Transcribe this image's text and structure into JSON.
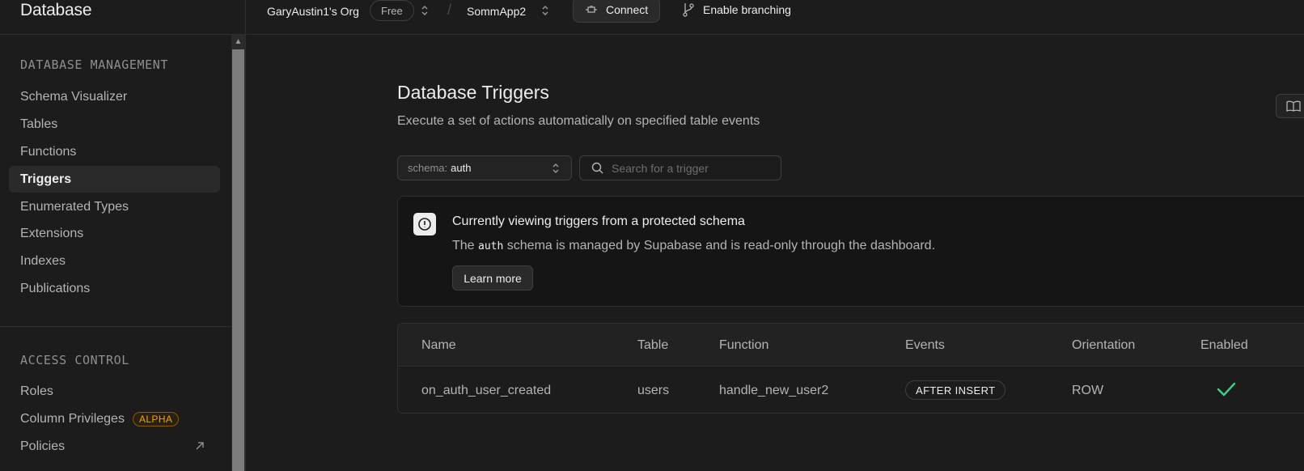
{
  "sidebar": {
    "title": "Database",
    "sections": [
      {
        "label": "DATABASE MANAGEMENT",
        "items": [
          {
            "label": "Schema Visualizer"
          },
          {
            "label": "Tables"
          },
          {
            "label": "Functions"
          },
          {
            "label": "Triggers",
            "active": true
          },
          {
            "label": "Enumerated Types"
          },
          {
            "label": "Extensions"
          },
          {
            "label": "Indexes"
          },
          {
            "label": "Publications"
          }
        ]
      },
      {
        "label": "ACCESS CONTROL",
        "items": [
          {
            "label": "Roles"
          },
          {
            "label": "Column Privileges",
            "badge": "ALPHA"
          },
          {
            "label": "Policies",
            "external": true
          }
        ]
      }
    ]
  },
  "topbar": {
    "org": "GaryAustin1's Org",
    "plan_badge": "Free",
    "project": "SommApp2",
    "connect_label": "Connect",
    "branching_label": "Enable branching"
  },
  "main": {
    "title": "Database Triggers",
    "subtitle": "Execute a set of actions automatically on specified table events",
    "schema_select": {
      "label": "schema:",
      "value": "auth"
    },
    "search": {
      "placeholder": "Search for a trigger",
      "value": ""
    },
    "alert": {
      "title": "Currently viewing triggers from a protected schema",
      "body_prefix": "The ",
      "body_code": "auth",
      "body_suffix": " schema is managed by Supabase and is read-only through the dashboard.",
      "button_label": "Learn more"
    },
    "table": {
      "columns": [
        "Name",
        "Table",
        "Function",
        "Events",
        "Orientation",
        "Enabled"
      ],
      "rows": [
        {
          "name": "on_auth_user_created",
          "table": "users",
          "function": "handle_new_user2",
          "events": "AFTER INSERT",
          "orientation": "ROW",
          "enabled": true
        }
      ]
    }
  },
  "colors": {
    "background": "#1c1c1c",
    "border": "#2e2e2e",
    "text_primary": "#ededed",
    "text_secondary": "#b4b4b4",
    "alpha_badge": "#f1a10d",
    "enabled_check": "#3ecf8e"
  },
  "icons": {
    "updown": "chevron-up-down-icon",
    "connect": "plug-icon",
    "branching": "git-branch-icon",
    "search": "search-icon",
    "alert": "alert-circle-icon",
    "docs": "book-open-icon",
    "external": "external-link-icon",
    "enabled": "check-icon"
  }
}
